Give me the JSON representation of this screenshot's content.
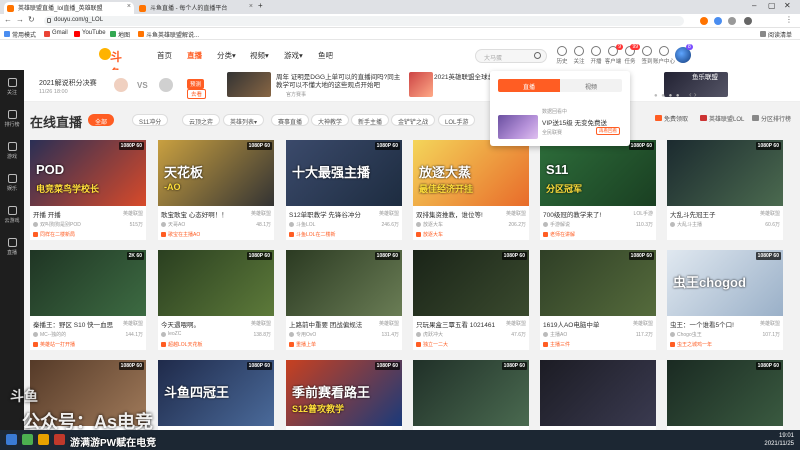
{
  "browser": {
    "tabs": [
      {
        "label": "英雄联盟直播_lol直播_英雄联盟"
      },
      {
        "label": "斗鱼直播 - 每个人的直播平台"
      }
    ],
    "url": "douyu.com/g_LOL",
    "bookmarks": [
      "常用模式",
      "Gmail",
      "YouTube",
      "地图",
      "斗鱼英雄联盟解说..."
    ],
    "reading_list": "阅读清单"
  },
  "header": {
    "logo": "斗鱼",
    "nav": [
      "首页",
      "直播",
      "分类",
      "视频",
      "游戏",
      "鱼吧"
    ],
    "search_placeholder": "大马蛋",
    "icons": [
      {
        "label": "历史",
        "badge": ""
      },
      {
        "label": "关注",
        "badge": ""
      },
      {
        "label": "开播",
        "badge": ""
      },
      {
        "label": "客户端",
        "badge": "9"
      },
      {
        "label": "任务",
        "badge": "99"
      },
      {
        "label": "签到",
        "badge": ""
      },
      {
        "label": "账户中心",
        "badge": ""
      }
    ],
    "avatar_badge": "8"
  },
  "sidebar": [
    "关注",
    "排行榜",
    "游戏",
    "娱乐",
    "云游戏",
    "直播"
  ],
  "banner": {
    "match_title": "2021解说积分决赛",
    "match_time": "11/26 18:00",
    "vs": "VS",
    "predict": "预测",
    "predict_sub": "去看",
    "promo1_text": "周年 证明是DGG上单可以的直播间吗?同主教学可以不懂大地的这些观点开始吧",
    "promo1_sub": "官方赛事",
    "promo2_text": "2021英雄联盟全球总决赛",
    "promo3_text": "鱼乐联盟",
    "dots": "● ● ● ●",
    "arrows": "‹ ›"
  },
  "section": {
    "title": "在线直播",
    "filters": [
      "全部",
      "S11冲分",
      "云顶之弈",
      "英雄列表",
      "赛事直播",
      "大神教学",
      "新手主播",
      "金铲铲之战",
      "LOL手游"
    ],
    "right_filters": [
      "免费领取",
      "英雄联盟LOL",
      "分区排行榜"
    ]
  },
  "dropdown": {
    "tabs": [
      "直播",
      "视频"
    ],
    "header": "数据回看中",
    "title": "VIP送15级 无变免费送",
    "sub": "全民联赛",
    "button": "再看回看"
  },
  "cards": [
    {
      "title": "开播 开播",
      "cat": "英雄联盟",
      "host": "双叫狗狗是别POD",
      "views": "515万",
      "tag": "同样在二楼新局",
      "overlay": "POD",
      "overlay2": "电竞菜鸟学校长",
      "quality": "1080P 60"
    },
    {
      "title": "歌宝歌宝 心态好啊！！",
      "cat": "英雄联盟",
      "host": "天哥AO",
      "views": "48.1万",
      "tag": "歌宝在主播AO",
      "overlay": "天花板",
      "overlay2": "-AO",
      "quality": "1080P 60"
    },
    {
      "title": "S12单职教学 先锋谷冲分",
      "cat": "英雄联盟",
      "host": "斗鱼LOL",
      "views": "246.6万",
      "tag": "斗鱼LOL在二楼新",
      "overlay": "十大最强主播",
      "overlay2": "",
      "quality": "1080P 60"
    },
    {
      "title": "双排集资推教，谁位等!",
      "cat": "英雄联盟",
      "host": "放逐大车",
      "views": "206.2万",
      "tag": "放逐大车",
      "overlay": "放逐大蒸",
      "overlay2": "最佳经济开挂",
      "quality": ""
    },
    {
      "title": "700级冠的教学来了!",
      "cat": "LOL手游",
      "host": "手游解说",
      "views": "110.3万",
      "tag": "老师在讲解",
      "overlay": "S11",
      "overlay2": "分区冠军",
      "quality": "1080P 60"
    },
    {
      "title": "大乱斗先冠王子",
      "cat": "英雄联盟",
      "host": "大乱斗主播",
      "views": "60.6万",
      "tag": "",
      "overlay": "",
      "overlay2": "",
      "quality": "1080P 60"
    },
    {
      "title": "秦播王：野区 S10 快一血思路",
      "cat": "英雄联盟",
      "host": "MC--独的的",
      "views": "144.1万",
      "tag": "英雄站一打开播",
      "overlay": "",
      "overlay2": "",
      "quality": "2K 60"
    },
    {
      "title": "今天遇喂啊。",
      "cat": "英雄联盟",
      "host": "leoZC",
      "views": "138.8万",
      "tag": "超越LOL天花板",
      "overlay": "",
      "overlay2": "",
      "quality": "1080P 60"
    },
    {
      "title": "上路前中重要 团战偏规法",
      "cat": "英雄联盟",
      "host": "专用OvO",
      "views": "131.4万",
      "tag": "重播上单",
      "overlay": "",
      "overlay2": "",
      "quality": "1080P 60"
    },
    {
      "title": "只玩果盒三覃五看 1021461",
      "cat": "英雄联盟",
      "host": "虎跃冲大",
      "views": "47.6万",
      "tag": "独立一二大",
      "overlay": "",
      "overlay2": "",
      "quality": "1080P 60"
    },
    {
      "title": "1619人AO电脑中单",
      "cat": "英雄联盟",
      "host": "主播AO",
      "views": "117.2万",
      "tag": "主播三件",
      "overlay": "",
      "overlay2": "",
      "quality": "1080P 60"
    },
    {
      "title": "虫王：一个谁看5个口!",
      "cat": "英雄联盟",
      "host": "Chogo虫王",
      "views": "107.1万",
      "tag": "虫王之城鸡一年",
      "overlay": "虫王chogod",
      "overlay2": "",
      "quality": "1080P 60"
    },
    {
      "title": "",
      "cat": "",
      "host": "",
      "views": "",
      "tag": "",
      "overlay": "",
      "overlay2": "",
      "quality": "1080P 60"
    },
    {
      "title": "",
      "cat": "",
      "host": "",
      "views": "",
      "tag": "",
      "overlay": "斗鱼四冠王",
      "overlay2": "",
      "quality": "1080P 60"
    },
    {
      "title": "",
      "cat": "",
      "host": "",
      "views": "",
      "tag": "",
      "overlay": "季前赛看路王",
      "overlay2": "S12普攻教学",
      "quality": "1080P 60"
    },
    {
      "title": "",
      "cat": "",
      "host": "",
      "views": "",
      "tag": "",
      "overlay": "",
      "overlay2": "",
      "quality": "1080P 60"
    },
    {
      "title": "",
      "cat": "",
      "host": "",
      "views": "",
      "tag": "",
      "overlay": "",
      "overlay2": "",
      "quality": ""
    },
    {
      "title": "",
      "cat": "",
      "host": "",
      "views": "",
      "tag": "",
      "overlay": "",
      "overlay2": "",
      "quality": "1080P 60"
    }
  ],
  "watermark": "公众号：As电竞",
  "watermark_top": "斗鱼",
  "taskbar_text": "游满游PW赋在电竞",
  "clock": {
    "time": "19:01",
    "date": "2021/11/25"
  },
  "colors": {
    "accent": "#ff5d23",
    "sidebar": "#1e1e1e",
    "taskbar": "#1c2733"
  }
}
